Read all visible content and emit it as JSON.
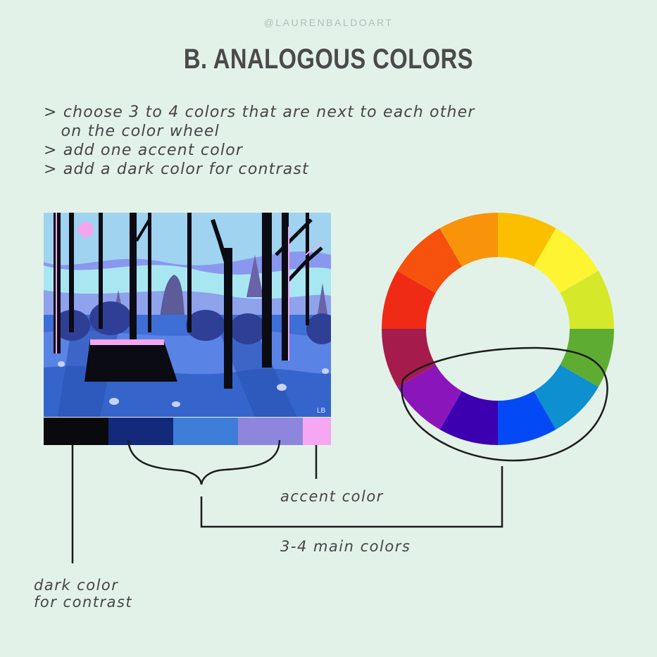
{
  "handle": "@LAURENBALDOART",
  "title": "B. ANALOGOUS COLORS",
  "bullets": [
    "> choose 3 to 4 colors that are next to each other",
    "   on the color wheel",
    "> add one accent color",
    "> add a dark color for contrast"
  ],
  "illustration": {
    "signature": "LB",
    "colors": {
      "sky": "#7fb8e8",
      "sky_light": "#a9e2f0",
      "ground": "#3f74d8",
      "ground_light": "#8a97ee",
      "trees": "#0a0a10",
      "accent": "#f3a6ef"
    }
  },
  "palette": [
    {
      "name": "dark",
      "color": "#0a0a0c"
    },
    {
      "name": "navy",
      "color": "#13297a"
    },
    {
      "name": "blue",
      "color": "#3f7ed8"
    },
    {
      "name": "lavender",
      "color": "#8e85dd"
    },
    {
      "name": "pink",
      "color": "#f6a7f1"
    }
  ],
  "color_wheel": {
    "segments": [
      "#fbbf00",
      "#fef432",
      "#d6e82a",
      "#5ead32",
      "#0d8fd0",
      "#0449f6",
      "#3c00b1",
      "#8a16bb",
      "#a51b4c",
      "#ef2b16",
      "#f6520d",
      "#f9940a"
    ]
  },
  "labels": {
    "accent": "accent color",
    "main": "3-4 main colors",
    "dark_line1": "dark color",
    "dark_line2": "for contrast"
  }
}
